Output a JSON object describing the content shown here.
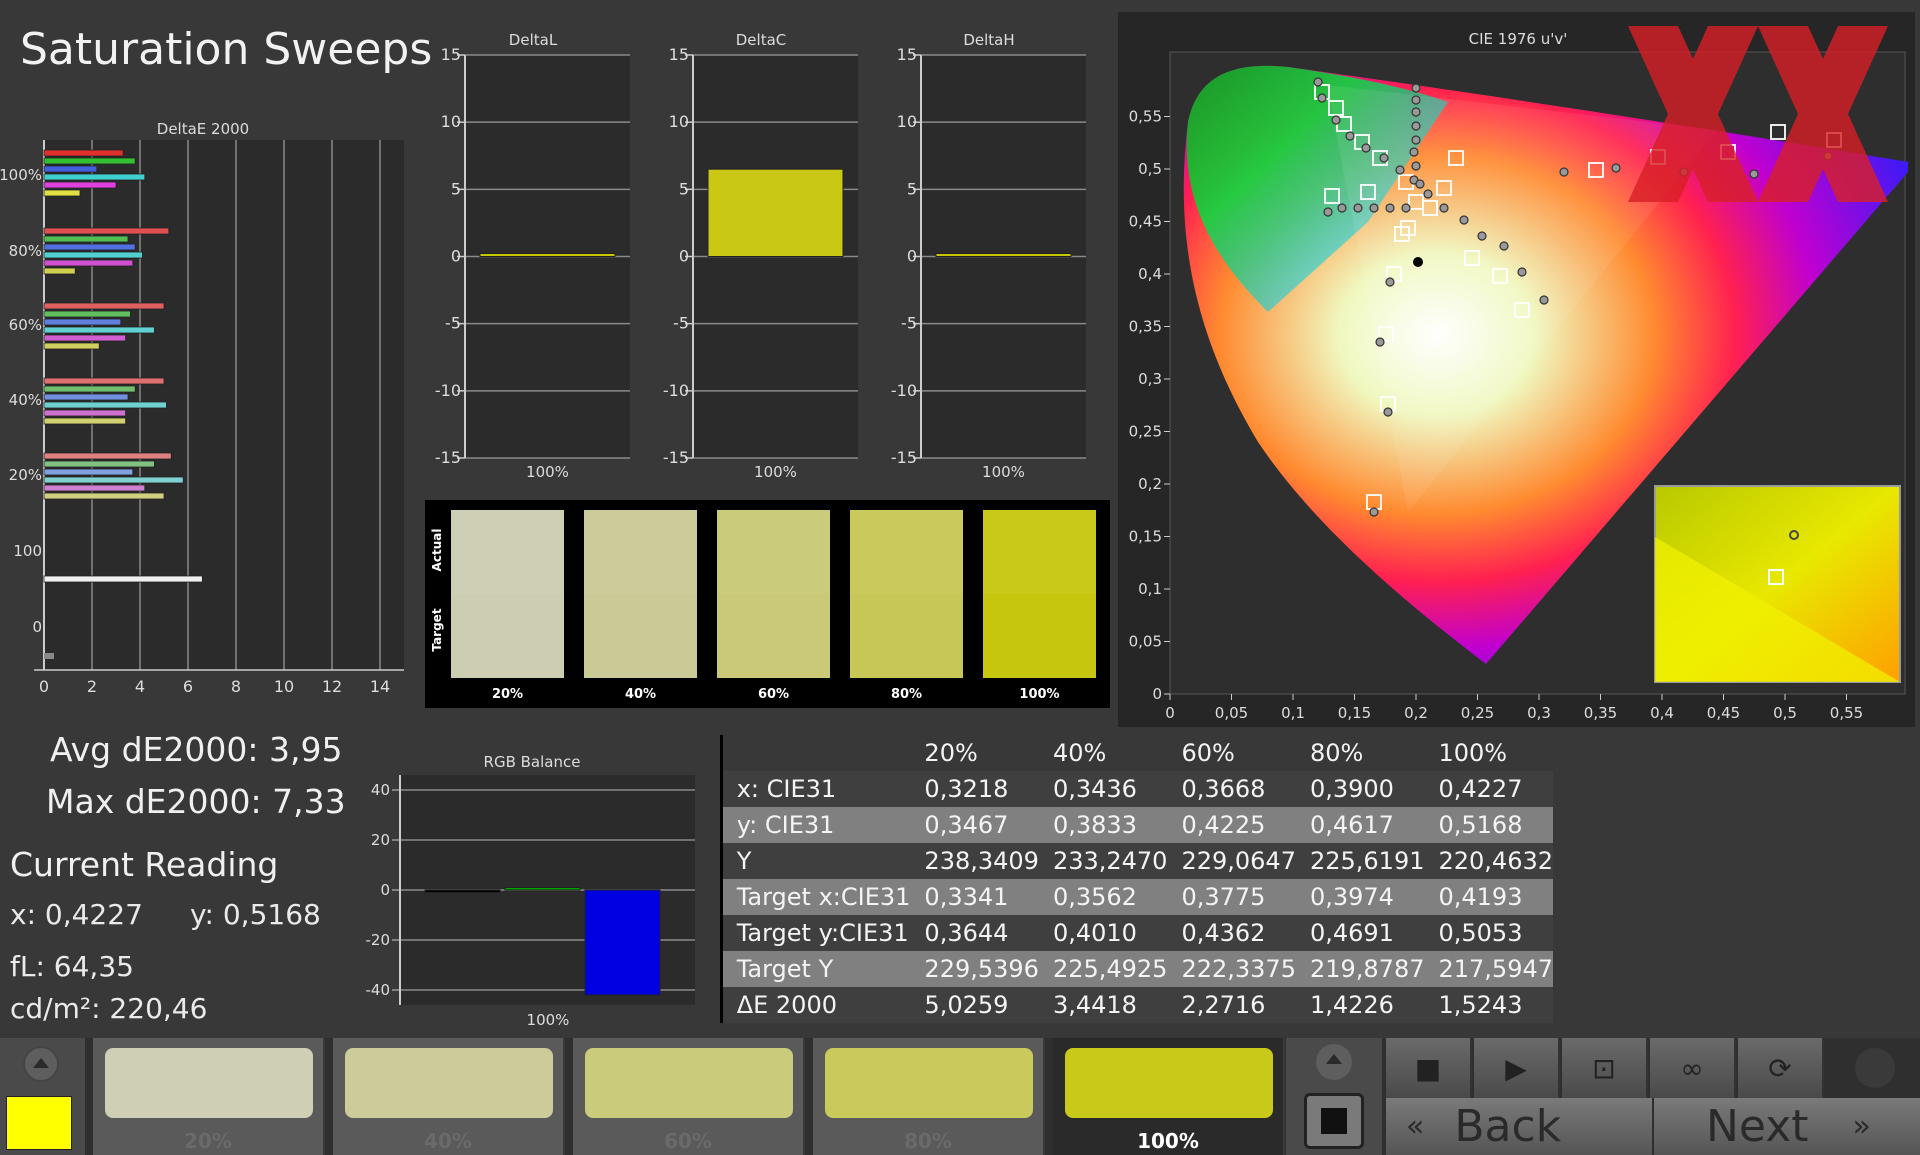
{
  "title": "Saturation Sweeps",
  "delta_e_chart": {
    "title": "DeltaE 2000",
    "y_labels": [
      "100%",
      "80%",
      "60%",
      "40%",
      "20%",
      "100",
      "0"
    ],
    "x_ticks": [
      "0",
      "2",
      "4",
      "6",
      "8",
      "10",
      "12",
      "14"
    ]
  },
  "delta_l": {
    "title": "DeltaL",
    "x_label": "100%",
    "ticks": [
      "15",
      "10",
      "5",
      "0",
      "-5",
      "-10",
      "-15"
    ],
    "value": 0.1
  },
  "delta_c": {
    "title": "DeltaC",
    "x_label": "100%",
    "ticks": [
      "15",
      "10",
      "5",
      "0",
      "-5",
      "-10",
      "-15"
    ],
    "value": 6.5
  },
  "delta_h": {
    "title": "DeltaH",
    "x_label": "100%",
    "ticks": [
      "15",
      "10",
      "5",
      "0",
      "-5",
      "-10",
      "-15"
    ],
    "value": 0.1
  },
  "swatches": {
    "actual_label": "Actual",
    "target_label": "Target",
    "items": [
      {
        "label": "20%",
        "actual": "#cfcfb6",
        "target": "#cdcdb2"
      },
      {
        "label": "40%",
        "actual": "#cccc9a",
        "target": "#caca96"
      },
      {
        "label": "60%",
        "actual": "#cbcb7c",
        "target": "#c9c978"
      },
      {
        "label": "80%",
        "actual": "#c9c95c",
        "target": "#c7c757"
      },
      {
        "label": "100%",
        "actual": "#c9c91a",
        "target": "#c6c60e"
      }
    ]
  },
  "cie": {
    "title": "CIE 1976 u'v'",
    "y_ticks": [
      "0,55",
      "0,5",
      "0,45",
      "0,4",
      "0,35",
      "0,3",
      "0,25",
      "0,2",
      "0,15",
      "0,1",
      "0,05",
      "0"
    ],
    "x_ticks": [
      "0",
      "0,05",
      "0,1",
      "0,15",
      "0,2",
      "0,25",
      "0,3",
      "0,35",
      "0,4",
      "0,45",
      "0,5",
      "0,55"
    ]
  },
  "stats": {
    "avg": "Avg dE2000: 3,95",
    "max": "Max dE2000: 7,33",
    "current_reading": "Current Reading",
    "x": "x: 0,4227",
    "y": "y: 0,5168",
    "fl": "fL: 64,35",
    "cdm2": "cd/m²: 220,46"
  },
  "rgb_balance": {
    "title": "RGB Balance",
    "ticks": [
      "40",
      "20",
      "0",
      "-20",
      "-40"
    ],
    "x_label": "100%",
    "r": -1,
    "g": 1,
    "b": -42
  },
  "table": {
    "headers": [
      "20%",
      "40%",
      "60%",
      "80%",
      "100%"
    ],
    "rows": [
      {
        "label": "x: CIE31",
        "values": [
          "0,3218",
          "0,3436",
          "0,3668",
          "0,3900",
          "0,4227"
        ]
      },
      {
        "label": "y: CIE31",
        "values": [
          "0,3467",
          "0,3833",
          "0,4225",
          "0,4617",
          "0,5168"
        ]
      },
      {
        "label": "Y",
        "values": [
          "238,3409",
          "233,2470",
          "229,0647",
          "225,6191",
          "220,4632"
        ]
      },
      {
        "label": "Target x:CIE31",
        "values": [
          "0,3341",
          "0,3562",
          "0,3775",
          "0,3974",
          "0,4193"
        ]
      },
      {
        "label": "Target y:CIE31",
        "values": [
          "0,3644",
          "0,4010",
          "0,4362",
          "0,4691",
          "0,5053"
        ]
      },
      {
        "label": "Target Y",
        "values": [
          "229,5396",
          "225,4925",
          "222,3375",
          "219,8787",
          "217,5947"
        ]
      },
      {
        "label": "ΔE 2000",
        "values": [
          "5,0259",
          "3,4418",
          "2,2716",
          "1,4226",
          "1,5243"
        ]
      }
    ]
  },
  "bottom": {
    "items": [
      {
        "label": "20%",
        "color": "#cfcfb6"
      },
      {
        "label": "40%",
        "color": "#cccc9a"
      },
      {
        "label": "60%",
        "color": "#cbcb7c"
      },
      {
        "label": "80%",
        "color": "#c9c95c"
      },
      {
        "label": "100%",
        "color": "#c9c91a"
      }
    ],
    "current_color": "#ffff00",
    "back": "Back",
    "next": "Next"
  }
}
